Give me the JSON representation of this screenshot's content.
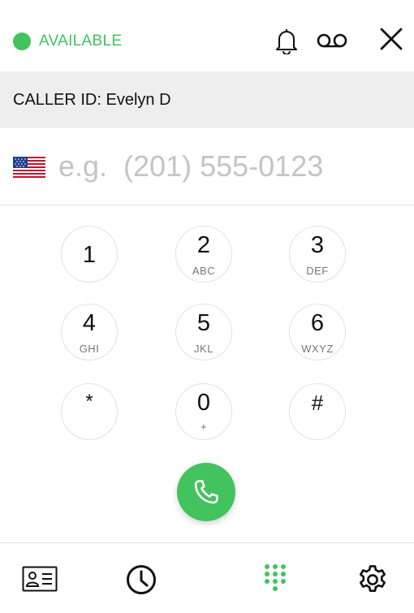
{
  "header": {
    "status_label": "AVAILABLE",
    "status_color": "#43c35e",
    "icons": [
      "bell-icon",
      "voicemail-icon",
      "close-icon"
    ]
  },
  "caller_id": {
    "text": "CALLER ID: Evelyn D"
  },
  "number_input": {
    "value": "",
    "placeholder": "e.g.  (201) 555-0123",
    "country_flag": "us-flag-icon"
  },
  "keypad": {
    "keys": [
      {
        "digit": "1",
        "letters": ""
      },
      {
        "digit": "2",
        "letters": "ABC"
      },
      {
        "digit": "3",
        "letters": "DEF"
      },
      {
        "digit": "4",
        "letters": "GHI"
      },
      {
        "digit": "5",
        "letters": "JKL"
      },
      {
        "digit": "6",
        "letters": "WXYZ"
      },
      {
        "digit": "*",
        "letters": ""
      },
      {
        "digit": "0",
        "letters": "+"
      },
      {
        "digit": "#",
        "letters": ""
      }
    ]
  },
  "call_button": {
    "icon": "phone-icon",
    "color": "#43c35e"
  },
  "bottom_nav": {
    "items": [
      {
        "icon": "contacts-icon",
        "active": false
      },
      {
        "icon": "history-clock-icon",
        "active": false
      },
      {
        "icon": "dialpad-icon",
        "active": true
      },
      {
        "icon": "gear-icon",
        "active": false
      }
    ],
    "active_color": "#43c35e"
  }
}
